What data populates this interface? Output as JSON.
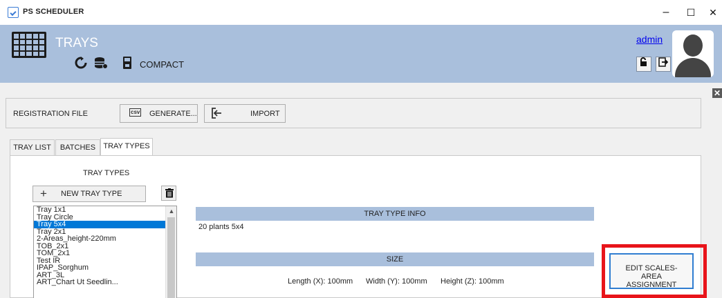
{
  "window": {
    "title": "PS SCHEDULER",
    "controls": {
      "minimize": "–",
      "maximize": "☐",
      "close": "✕"
    }
  },
  "header": {
    "page_title": "TRAYS",
    "compact_label": "COMPACT",
    "username": "admin",
    "icons": [
      "refresh-icon",
      "database-icon",
      "save-icon",
      "unlock-icon",
      "logout-icon",
      "user-avatar-icon"
    ]
  },
  "registration": {
    "label": "REGISTRATION FILE",
    "generate_label": "GENERATE...",
    "generate_icon_text": "csv",
    "import_label": "IMPORT"
  },
  "tabs": [
    {
      "label": "TRAY LIST",
      "active": false
    },
    {
      "label": "BATCHES",
      "active": false
    },
    {
      "label": "TRAY TYPES",
      "active": true
    }
  ],
  "tray_types": {
    "title": "TRAY TYPES",
    "new_button_label": "NEW TRAY TYPE",
    "items": [
      {
        "label": "Tray 1x1",
        "selected": false
      },
      {
        "label": "Tray Circle",
        "selected": false
      },
      {
        "label": "Tray 5x4",
        "selected": true
      },
      {
        "label": "Tray 2x1",
        "selected": false
      },
      {
        "label": "2-Areas_height-220mm",
        "selected": false
      },
      {
        "label": "TOB_2x1",
        "selected": false
      },
      {
        "label": "TOM_2x1",
        "selected": false
      },
      {
        "label": "Test IR",
        "selected": false
      },
      {
        "label": "IPAP_Sorghum",
        "selected": false
      },
      {
        "label": "ART_3L",
        "selected": false
      },
      {
        "label": "ART_Chart Ut Seedlin...",
        "selected": false
      }
    ]
  },
  "info": {
    "header": "TRAY TYPE INFO",
    "description": "20 plants 5x4"
  },
  "size": {
    "header": "SIZE",
    "length": "Length (X): 100mm",
    "width": "Width (Y): 100mm",
    "height": "Height (Z): 100mm"
  },
  "edit_button_label": "EDIT SCALES-AREA ASSIGNMENT",
  "colors": {
    "header_bg": "#a9bfdc",
    "selection": "#0078d7",
    "highlight": "#e8141a",
    "link": "#0000ee"
  }
}
